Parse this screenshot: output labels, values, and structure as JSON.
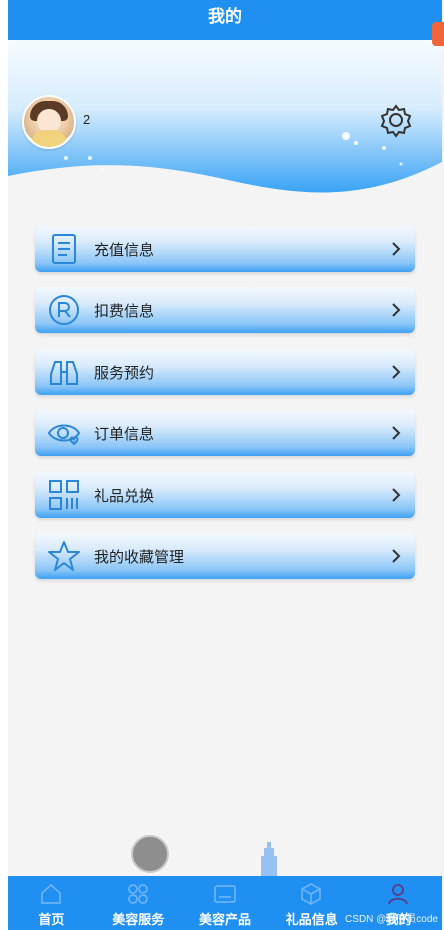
{
  "header": {
    "title": "我的"
  },
  "profile": {
    "username": "2",
    "settings_icon": "gear-icon"
  },
  "menu": [
    {
      "label": "充值信息",
      "icon": "document-list-icon"
    },
    {
      "label": "扣费信息",
      "icon": "registered-r-icon"
    },
    {
      "label": "服务预约",
      "icon": "binoculars-icon"
    },
    {
      "label": "订单信息",
      "icon": "eye-heart-icon"
    },
    {
      "label": "礼品兑换",
      "icon": "qr-code-icon"
    },
    {
      "label": "我的收藏管理",
      "icon": "star-icon"
    }
  ],
  "bottom_nav": [
    {
      "label": "首页",
      "icon": "home-icon"
    },
    {
      "label": "美容服务",
      "icon": "flower-grid-icon"
    },
    {
      "label": "美容产品",
      "icon": "image-card-icon"
    },
    {
      "label": "礼品信息",
      "icon": "gift-box-icon"
    },
    {
      "label": "我的",
      "icon": "user-icon",
      "active": true
    }
  ],
  "watermark": "CSDN @程序员code",
  "colors": {
    "primary": "#1f8ff2",
    "menu_gradient_end": "#3ea1f4",
    "page_bg": "#f4f4f4"
  }
}
